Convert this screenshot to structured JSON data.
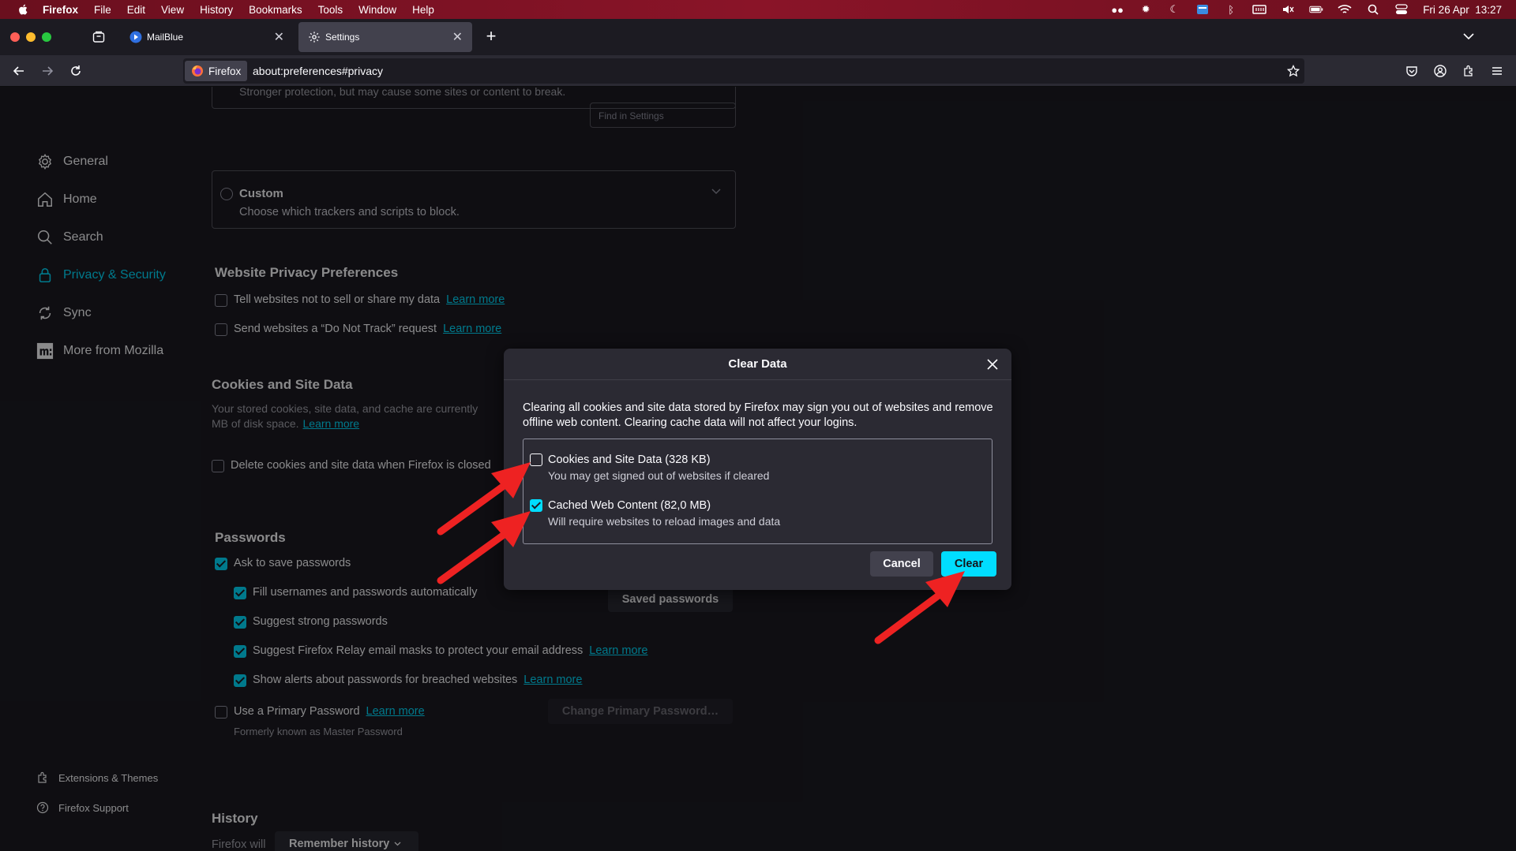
{
  "menubar": {
    "app": "Firefox",
    "items": [
      "File",
      "Edit",
      "View",
      "History",
      "Bookmarks",
      "Tools",
      "Window",
      "Help"
    ],
    "clock": "Fri 26 Apr  13:27"
  },
  "tabs": [
    {
      "label": "MailBlue"
    },
    {
      "label": "Settings"
    }
  ],
  "urlbar": {
    "identity": "Firefox",
    "url": "about:preferences#privacy"
  },
  "find": {
    "placeholder": "Find in Settings"
  },
  "sidebar": {
    "items": [
      "General",
      "Home",
      "Search",
      "Privacy & Security",
      "Sync",
      "More from Mozilla"
    ],
    "footer": [
      "Extensions & Themes",
      "Firefox Support"
    ]
  },
  "tracking": {
    "strict_desc_partial": "Stronger protection, but may cause some sites or content to break.",
    "custom_title": "Custom",
    "custom_desc": "Choose which trackers and scripts to block."
  },
  "website_privacy": {
    "heading": "Website Privacy Preferences",
    "opt1": "Tell websites not to sell or share my data",
    "opt2": "Send websites a “Do Not Track” request",
    "learn_more": "Learn more"
  },
  "cookies": {
    "heading": "Cookies and Site Data",
    "desc_line1": "Your stored cookies, site data, and cache are currently",
    "desc_line2": "MB of disk space.",
    "learn_more": "Learn more",
    "delete_option": "Delete cookies and site data when Firefox is closed"
  },
  "passwords": {
    "heading": "Passwords",
    "ask": "Ask to save passwords",
    "fill": "Fill usernames and passwords automatically",
    "suggest": "Suggest strong passwords",
    "relay": "Suggest Firefox Relay email masks to protect your email address",
    "alerts": "Show alerts about passwords for breached websites",
    "primary": "Use a Primary Password",
    "primary_sub": "Formerly known as Master Password",
    "saved_btn": "Saved passwords",
    "change_btn": "Change Primary Password…",
    "learn_more": "Learn more"
  },
  "history": {
    "heading": "History",
    "firefox_will": "Firefox will",
    "select": "Remember history"
  },
  "dialog": {
    "title": "Clear Data",
    "desc": "Clearing all cookies and site data stored by Firefox may sign you out of websites and remove offline web content. Clearing cache data will not affect your logins.",
    "opt1_label": "Cookies and Site Data (328 KB)",
    "opt1_sub": "You may get signed out of websites if cleared",
    "opt2_label": "Cached Web Content (82,0 MB)",
    "opt2_sub": "Will require websites to reload images and data",
    "cancel": "Cancel",
    "clear": "Clear"
  },
  "colors": {
    "accent": "#00ddff",
    "arrow": "#ee2222",
    "menubar": "#7a1224"
  }
}
